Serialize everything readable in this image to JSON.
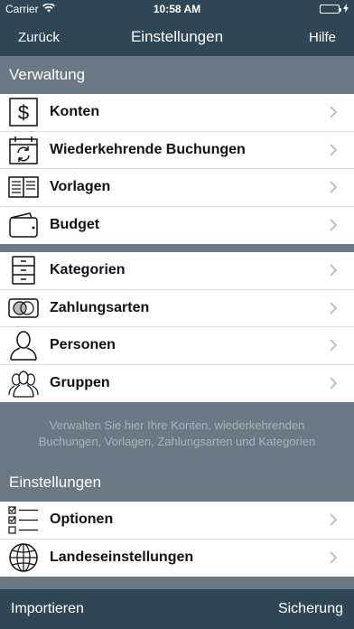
{
  "status_bar": {
    "carrier": "Carrier",
    "time": "10:58 AM"
  },
  "nav": {
    "back_label": "Zurück",
    "title": "Einstellungen",
    "help_label": "Hilfe"
  },
  "sections": {
    "verwaltung": "Verwaltung",
    "einstellungen": "Einstellungen"
  },
  "group1": [
    {
      "label": "Konten",
      "icon": "dollar-icon"
    },
    {
      "label": "Wiederkehrende Buchungen",
      "icon": "recurring-calendar-icon"
    },
    {
      "label": "Vorlagen",
      "icon": "template-book-icon"
    },
    {
      "label": "Budget",
      "icon": "wallet-icon"
    }
  ],
  "group2": [
    {
      "label": "Kategorien",
      "icon": "drawer-cabinet-icon"
    },
    {
      "label": "Zahlungsarten",
      "icon": "payment-card-icon"
    },
    {
      "label": "Personen",
      "icon": "person-icon"
    },
    {
      "label": "Gruppen",
      "icon": "group-people-icon"
    }
  ],
  "info_text": "Verwalten Sie hier Ihre Konten, wiederkehrenden Buchungen, Vorlagen, Zahlungsarten und Kategorien",
  "group3": [
    {
      "label": "Optionen",
      "icon": "checklist-icon"
    },
    {
      "label": "Landeseinstellungen",
      "icon": "globe-icon"
    }
  ],
  "toolbar": {
    "import_label": "Importieren",
    "backup_label": "Sicherung"
  }
}
